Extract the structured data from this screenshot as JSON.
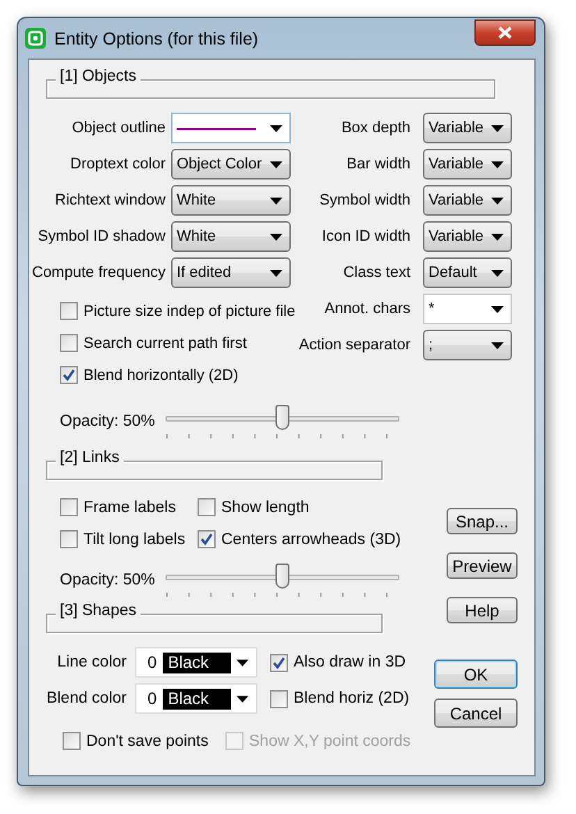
{
  "window": {
    "title": "Entity Options (for this file)"
  },
  "objects": {
    "title": "[1] Objects",
    "left_fields": [
      {
        "label": "Object outline",
        "kind": "line",
        "color": "#8b008b"
      },
      {
        "label": "Droptext color",
        "kind": "select",
        "value": "Object Color"
      },
      {
        "label": "Richtext window",
        "kind": "select",
        "value": "White"
      },
      {
        "label": "Symbol ID shadow",
        "kind": "select",
        "value": "White"
      },
      {
        "label": "Compute frequency",
        "kind": "select",
        "value": "If edited"
      }
    ],
    "right_fields": [
      {
        "label": "Box depth",
        "kind": "select",
        "value": "Variable"
      },
      {
        "label": "Bar width",
        "kind": "select",
        "value": "Variable"
      },
      {
        "label": "Symbol width",
        "kind": "select",
        "value": "Variable"
      },
      {
        "label": "Icon ID width",
        "kind": "select",
        "value": "Variable"
      },
      {
        "label": "Class text",
        "kind": "select",
        "value": "Default"
      },
      {
        "label": "Annot. chars",
        "kind": "edit",
        "value": "*"
      },
      {
        "label": "Action separator",
        "kind": "select",
        "value": ";"
      }
    ],
    "checkboxes": [
      {
        "label": "Picture size indep of picture file",
        "checked": false
      },
      {
        "label": "Search current path first",
        "checked": false
      },
      {
        "label": "Blend horizontally (2D)",
        "checked": true
      }
    ],
    "opacity": {
      "label": "Opacity: 50%",
      "level": 0.5
    }
  },
  "links": {
    "title": "[2] Links",
    "checkboxes": [
      {
        "label": "Frame labels",
        "checked": false
      },
      {
        "label": "Show length",
        "checked": false
      },
      {
        "label": "Tilt long labels",
        "checked": false
      },
      {
        "label": "Centers arrowheads (3D)",
        "checked": true
      }
    ],
    "opacity": {
      "label": "Opacity: 50%",
      "level": 0.5
    }
  },
  "shapes": {
    "title": "[3] Shapes",
    "colors": [
      {
        "label": "Line color",
        "index": "0",
        "value": "Black",
        "option": {
          "label": "Also draw in 3D",
          "checked": true
        }
      },
      {
        "label": "Blend color",
        "index": "0",
        "value": "Black",
        "option": {
          "label": "Blend horiz (2D)",
          "checked": false
        }
      }
    ],
    "bottom_checkboxes": [
      {
        "label": "Don't save points",
        "checked": false,
        "disabled": false
      },
      {
        "label": "Show X,Y point coords",
        "checked": false,
        "disabled": true
      }
    ]
  },
  "side_buttons": [
    {
      "label": "Snap...",
      "default": false
    },
    {
      "label": "Preview",
      "default": false
    },
    {
      "label": "Help",
      "default": false
    }
  ],
  "dialog_buttons": [
    {
      "label": "OK",
      "default": true
    },
    {
      "label": "Cancel",
      "default": false
    }
  ]
}
